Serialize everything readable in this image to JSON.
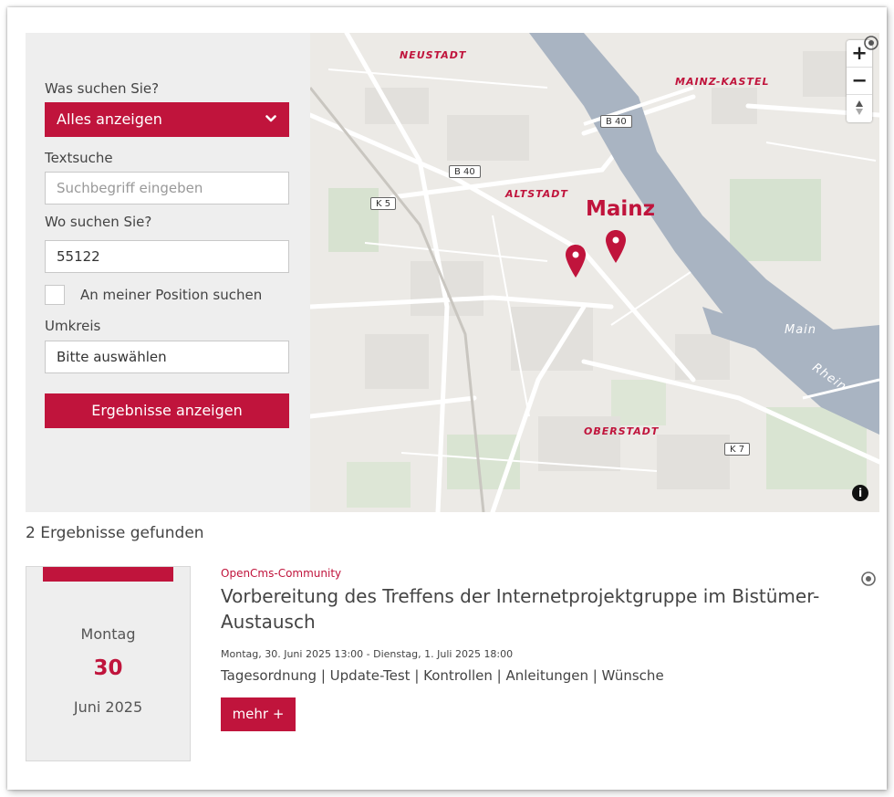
{
  "search": {
    "what_label": "Was suchen Sie?",
    "what_selected": "Alles anzeigen",
    "text_label": "Textsuche",
    "text_placeholder": "Suchbegriff eingeben",
    "where_label": "Wo suchen Sie?",
    "where_value": "55122",
    "position_checkbox_label": "An meiner Position suchen",
    "radius_label": "Umkreis",
    "radius_value": "Bitte auswählen",
    "submit_label": "Ergebnisse anzeigen"
  },
  "map": {
    "city": "Mainz",
    "districts": [
      "NEUSTADT",
      "MAINZ-KASTEL",
      "ALTSTADT",
      "OBERSTADT"
    ],
    "roads": [
      "B 40",
      "B 40",
      "K 5",
      "K 7"
    ],
    "rivers": [
      "Main",
      "Rhein"
    ],
    "zoom_in": "+",
    "zoom_out": "−",
    "compass": "▲▼",
    "info": "i",
    "marker_count": 2
  },
  "results": {
    "count_text": "2 Ergebnisse gefunden",
    "items": [
      {
        "weekday": "Montag",
        "day": "30",
        "month": "Juni 2025",
        "category": "OpenCms-Community",
        "title": "Vorbereitung des Treffens der Internetprojektgruppe im Bistümer-Austausch",
        "date_range": "Montag, 30. Juni 2025 13:00 - Dienstag, 1. Juli 2025 18:00",
        "tags": "Tagesordnung | Update-Test | Kontrollen | Anleitungen | Wünsche",
        "more_label": "mehr +"
      }
    ]
  },
  "colors": {
    "accent": "#c0143c",
    "panel_bg": "#eeeeee",
    "river": "#a9b4c2",
    "map_bg": "#eceae6"
  }
}
